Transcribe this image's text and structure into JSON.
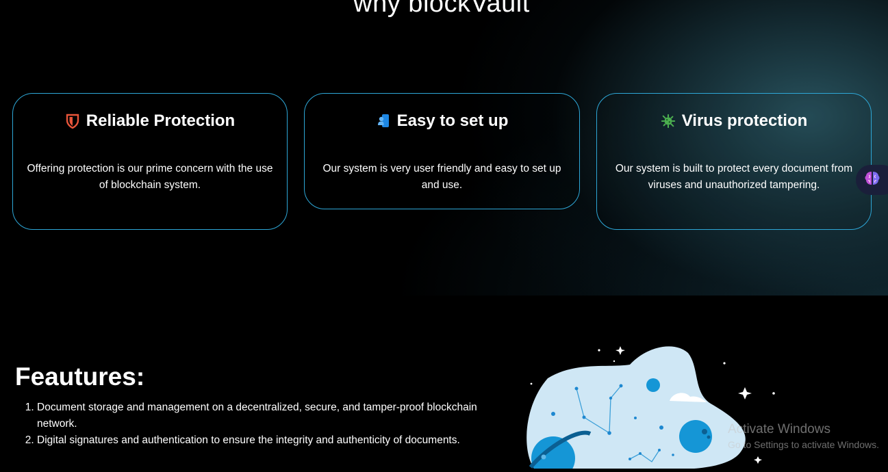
{
  "why": {
    "title": "why blockVault",
    "cards": [
      {
        "icon": "shield-icon",
        "icon_color": "#e8553a",
        "title": "Reliable Protection",
        "text": "Offering protection is our prime concern with the use of blockchain system."
      },
      {
        "icon": "user-setup-icon",
        "icon_color": "#1e88e5",
        "title": "Easy to set up",
        "text": "Our system is very user friendly and easy to set up and use."
      },
      {
        "icon": "virus-icon",
        "icon_color": "#4caf50",
        "title": "Virus protection",
        "text": "Our system is built to protect every document from viruses and unauthorized tampering."
      }
    ]
  },
  "assistant": {
    "icon": "brain-icon"
  },
  "features": {
    "title": "Feautures:",
    "items": [
      "Document storage and management on a decentralized, secure, and tamper-proof blockchain network.",
      "Digital signatures and authentication to ensure the integrity and authenticity of documents."
    ]
  },
  "illustration": {
    "icon": "space-planets-illustration"
  },
  "watermark": {
    "title": "Activate Windows",
    "subtitle": "Go to Settings to activate Windows."
  },
  "colors": {
    "card_border": "#2ea8d8",
    "background": "#000000",
    "accent_teal": "#2a5662"
  }
}
